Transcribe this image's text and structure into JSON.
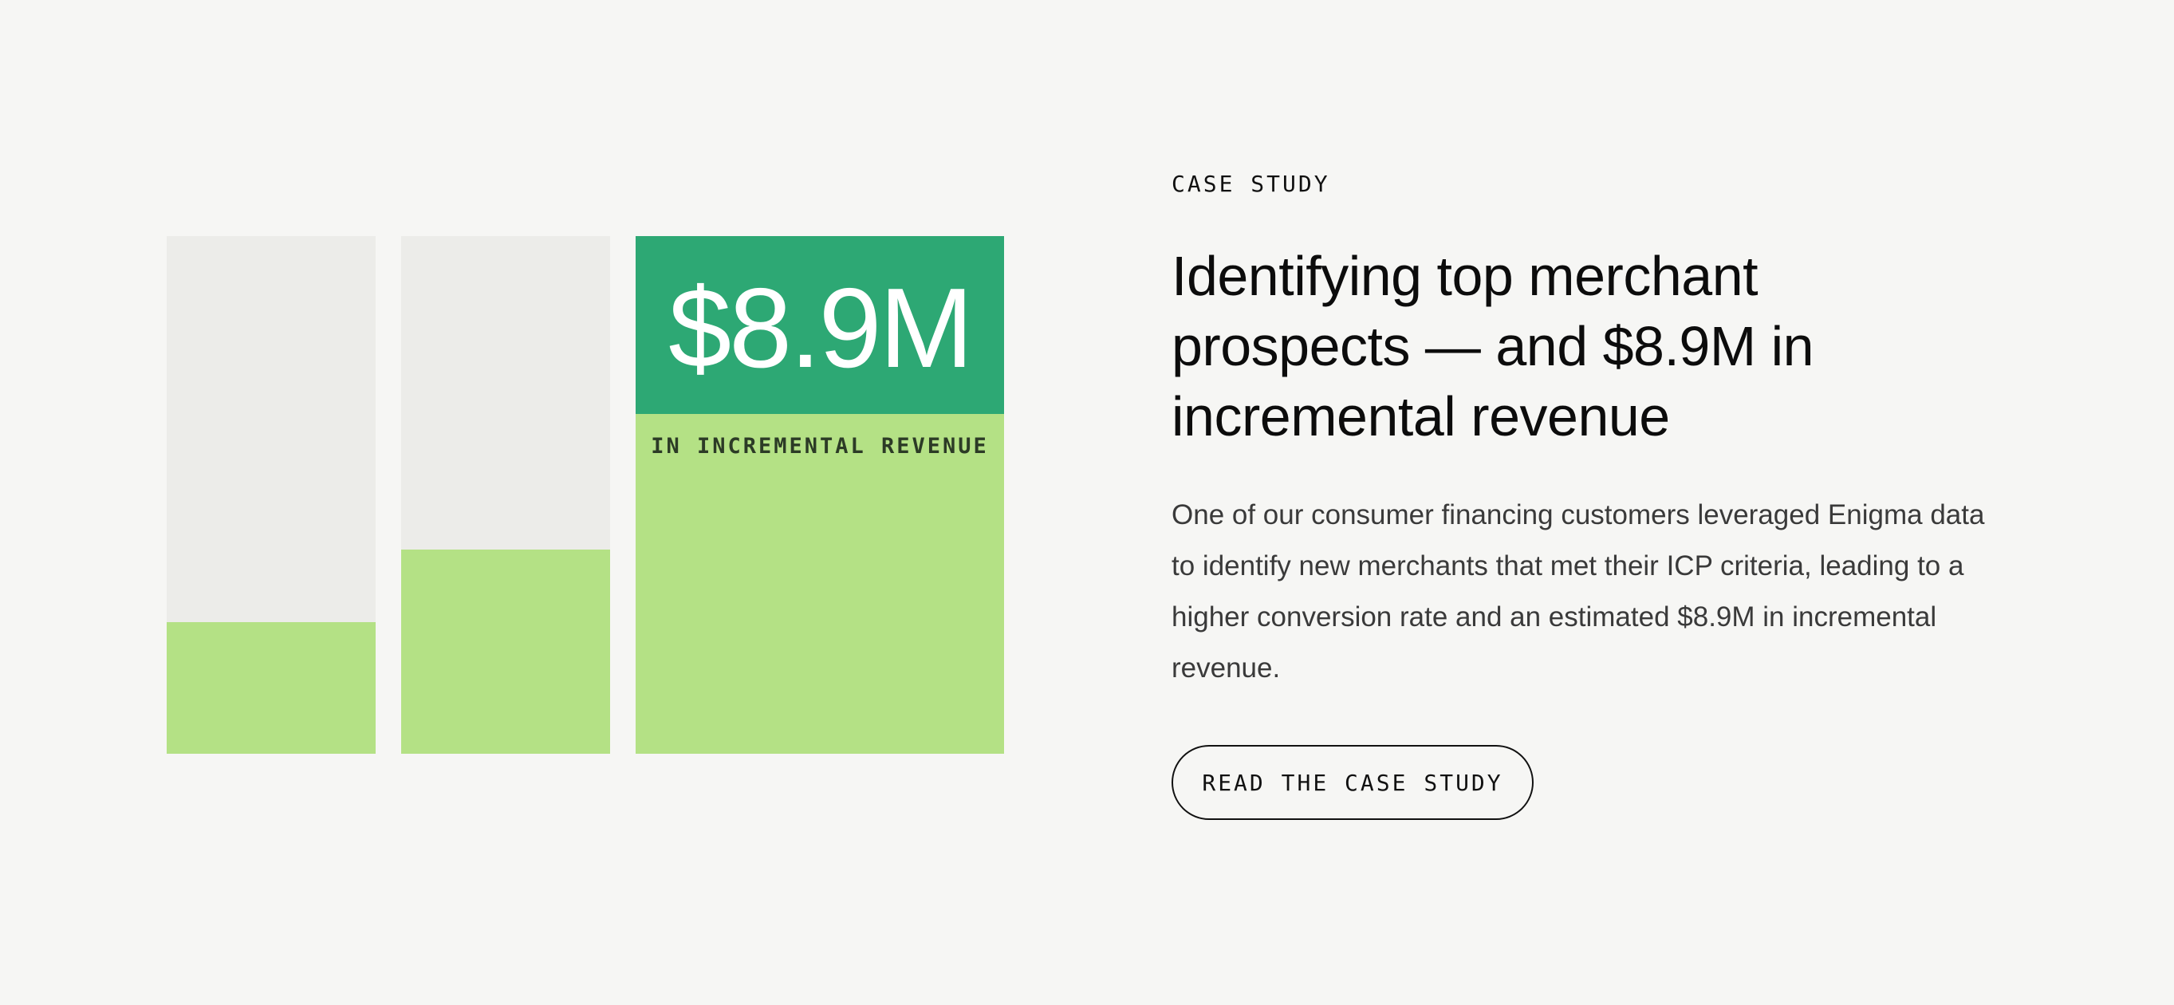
{
  "illustration": {
    "bars": [
      {
        "fill_fraction": 0.255
      },
      {
        "fill_fraction": 0.395
      },
      {
        "fill_fraction": 1.0
      }
    ],
    "stat": {
      "value": "$8.9M",
      "caption": "IN INCREMENTAL REVENUE"
    },
    "colors": {
      "track": "#ecece9",
      "fill": "#b4e185",
      "accent": "#2da874"
    }
  },
  "case_study": {
    "eyebrow": "CASE STUDY",
    "title": "Identifying top merchant prospects — and $8.9M in incremental revenue",
    "body": "One of our consumer financing customers leveraged Enigma data to identify new merchants that met their ICP criteria, leading to a higher conversion rate and an estimated $8.9M in incremental revenue.",
    "cta_label": "READ THE CASE STUDY"
  }
}
